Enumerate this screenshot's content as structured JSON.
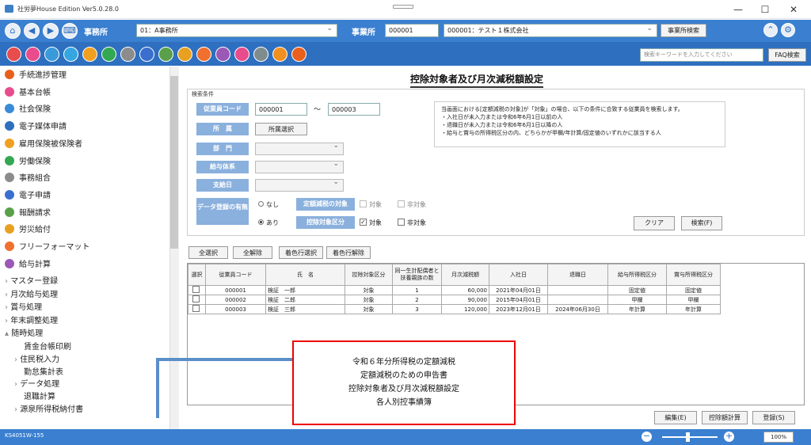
{
  "window": {
    "title": "社労夢House Edition Ver5.0.28.0",
    "minimize": "—",
    "maximize": "☐",
    "close": "✕"
  },
  "header": {
    "office_label": "事務所",
    "office_value": "01：A事務所",
    "business_label": "事業所",
    "business_code": "000001",
    "business_name": "000001：テスト１株式会社",
    "business_search": "事業所検索",
    "keyword_placeholder": "検索キーワードを入力してください",
    "faq_label": "FAQ検索",
    "func_colors": [
      "#e84c4c",
      "#e84c8c",
      "#3a9ad9",
      "#36a6e0",
      "#f0a020",
      "#33a853",
      "#8c8c8c",
      "#3a6fd0",
      "#5aa04a",
      "#e8a020",
      "#f07030",
      "#9b59b6",
      "#e84c8c",
      "#7f8c8d",
      "#f09020",
      "#e8601c"
    ]
  },
  "sidebar": {
    "items": [
      {
        "label": "手続進捗管理",
        "color": "#e8601c"
      },
      {
        "label": "基本台帳",
        "color": "#e84c8c"
      },
      {
        "label": "社会保険",
        "color": "#3a8ad9"
      },
      {
        "label": "電子媒体申請",
        "color": "#2e6fbf"
      },
      {
        "label": "雇用保険被保険者",
        "color": "#f0a020"
      },
      {
        "label": "労働保険",
        "color": "#33a853"
      },
      {
        "label": "事務組合",
        "color": "#8c8c8c"
      },
      {
        "label": "電子申請",
        "color": "#3a6fd0"
      },
      {
        "label": "報酬請求",
        "color": "#5aa04a"
      },
      {
        "label": "労災給付",
        "color": "#e8a020"
      },
      {
        "label": "フリーフォーマット",
        "color": "#f07030"
      },
      {
        "label": "給与計算",
        "color": "#9b59b6"
      }
    ],
    "sub": [
      "マスター登録",
      "月次給与処理",
      "賞与処理",
      "年末調整処理",
      "随時処理"
    ],
    "sub2": [
      "賃金台帳印刷",
      "住民税入力",
      "勤怠集計表",
      "データ処理",
      "退職計算",
      "源泉所得税納付書"
    ]
  },
  "screen": {
    "title": "控除対象者及び月次減税額設定",
    "cond_label": "検索条件",
    "emp_code_label": "従業員コード",
    "emp_from": "000001",
    "tilde": "～",
    "emp_to": "000003",
    "dept_label": "所　属",
    "dept_button": "所属選択",
    "section_label": "部　門",
    "pay_system_label": "給与体系",
    "pay_day_label": "支給日",
    "data_reg_label": "データ登録の有無",
    "radio_none": "なし",
    "radio_yes": "あり",
    "fixed_label": "定額減税の対象",
    "deduct_label": "控除対象区分",
    "opt_target": "対象",
    "opt_nontarget": "非対象",
    "info_lines": [
      "当画面における[定額減税の対象]が「対象」の場合、以下の条件に合致する従業員を検索します。",
      "・入社日が未入力または令和6年6月1日以前の人",
      "・退職日が未入力または令和6年6月1日以降の人",
      "・給与と賞与の所得税区分の内、どちらかが甲欄/年計算/固定値のいずれかに該当する人"
    ],
    "clear": "クリア",
    "search": "検索(F)",
    "select_all": "全選択",
    "deselect_all": "全解除",
    "color_select": "着色行選択",
    "color_deselect": "着色行解除",
    "edit": "編集(E)",
    "calc": "控除額計算",
    "register": "登録(S)"
  },
  "table": {
    "headers": [
      "選択",
      "従業員コード",
      "氏　名",
      "控除対象区分",
      "同一生計配偶者と扶養親族の数",
      "月次減税額",
      "入社日",
      "退職日",
      "給与所得税区分",
      "賞与所得税区分"
    ],
    "rows": [
      [
        "",
        "000001",
        "検証　一郎",
        "対象",
        "1",
        "60,000",
        "2021年04月01日",
        "",
        "固定値",
        "固定値"
      ],
      [
        "",
        "000002",
        "検証　二郎",
        "対象",
        "2",
        "90,000",
        "2015年04月01日",
        "",
        "甲欄",
        "甲欄"
      ],
      [
        "",
        "000003",
        "検証　三郎",
        "対象",
        "3",
        "120,000",
        "2023年12月01日",
        "2024年06月30日",
        "年計算",
        "年計算"
      ]
    ]
  },
  "callout": {
    "lines": [
      "令和６年分所得税の定額減税",
      "定額減税のための申告書",
      "控除対象者及び月次減税額設定",
      "各人別控事績簿"
    ]
  },
  "status": {
    "code": "KS4051W-155",
    "zoom": "100%"
  }
}
